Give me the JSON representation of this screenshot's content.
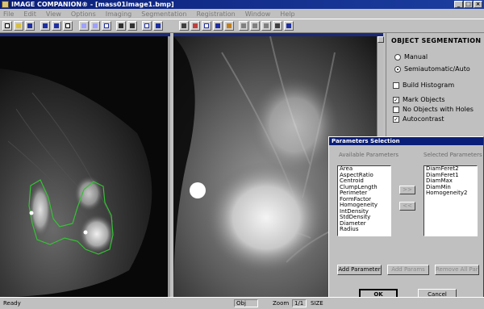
{
  "window": {
    "title": "IMAGE COMPANION® - [mass01image1.bmp]",
    "controls": [
      "_",
      "□",
      "×"
    ]
  },
  "menu": [
    "File",
    "Edit",
    "View",
    "Options",
    "Imaging",
    "Segmentation",
    "Registration",
    "Window",
    "Help"
  ],
  "segmentation": {
    "title": "OBJECT SEGMENTATION",
    "manual_label": "Manual",
    "semiauto_label": "Semiautomatic/Auto",
    "selected": "Semiautomatic/Auto",
    "build_histogram_label": "Build Histogram",
    "build_histogram_checked": false,
    "mark_objects_label": "Mark Objects",
    "mark_objects_checked": true,
    "no_holes_label": "No Objects with Holes",
    "no_holes_checked": false,
    "autocontrast_label": "Autocontrast",
    "autocontrast_checked": true
  },
  "dialog": {
    "title": "Parameters Selection",
    "available_label": "Available Parameters",
    "selected_label": "Selected Parameters",
    "available": [
      "Area",
      "AspectRatio",
      "Centroid",
      "ClumpLength",
      "Perimeter",
      "FormFactor",
      "Homogeneity",
      "IntDensity",
      "StdDensity",
      "Diameter",
      "Radius"
    ],
    "selected": [
      "DiamFeret2",
      "DiamFeret1",
      "DiamMax",
      "DiamMin",
      "Homogeneity2"
    ],
    "add_arrow": ">>",
    "remove_arrow": "<<",
    "add_parameter": "Add Parameter",
    "add_params": "Add Params",
    "remove_all": "Remove All Params",
    "ok": "OK",
    "cancel": "Cancel"
  },
  "status": {
    "ready": "Ready",
    "obj": "Obj",
    "zoom_label": "Zoom",
    "zoom_value": "1/1",
    "size_label": "SIZE"
  },
  "colors": {
    "titlebar": "#0a1e78",
    "contour": "#34c334",
    "chrome": "#c0c0c0"
  }
}
